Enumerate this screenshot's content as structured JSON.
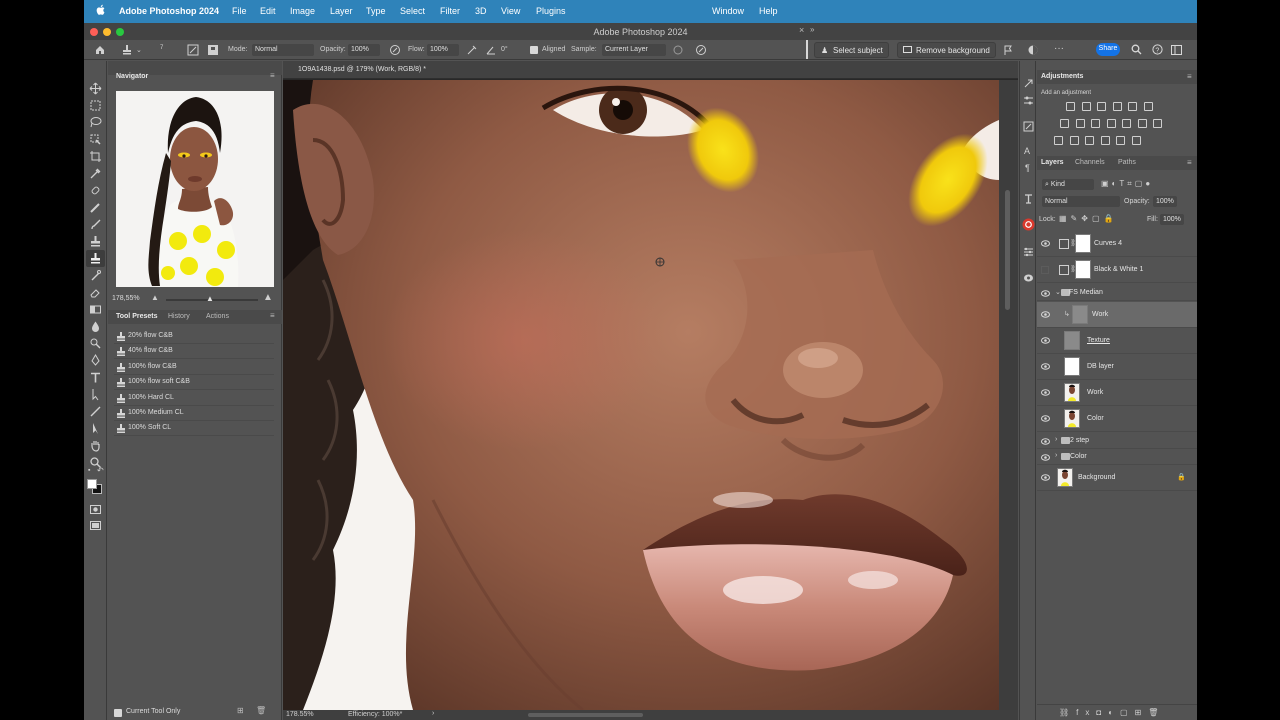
{
  "menubar": {
    "app_name": "Adobe Photoshop 2024",
    "items": [
      "File",
      "Edit",
      "Image",
      "Layer",
      "Type",
      "Select",
      "Filter",
      "3D",
      "View",
      "Plugins"
    ],
    "right_items": [
      "Window",
      "Help"
    ]
  },
  "window": {
    "title": "Adobe Photoshop 2024"
  },
  "options_bar": {
    "brush_size": "7",
    "mode_label": "Mode:",
    "mode_value": "Normal",
    "opacity_label": "Opacity:",
    "opacity_value": "100%",
    "flow_label": "Flow:",
    "flow_value": "100%",
    "angle_value": "0°",
    "aligned_label": "Aligned",
    "sample_label": "Sample:",
    "sample_value": "Current Layer",
    "select_subject": "Select subject",
    "remove_background": "Remove background",
    "share": "Share"
  },
  "navigator": {
    "tab": "Navigator",
    "zoom": "178,55%"
  },
  "tool_presets": {
    "tabs": [
      "Tool Presets",
      "History",
      "Actions"
    ],
    "items": [
      "20% flow C&B",
      "40% flow C&B",
      "100% flow C&B",
      "100% flow soft C&B",
      "100% Hard CL",
      "100% Medium CL",
      "100% Soft CL"
    ],
    "footer": "Current Tool Only"
  },
  "document": {
    "tab_title": "1O9A1438.psd @ 179% (Work, RGB/8) *",
    "status_zoom": "178.55%",
    "status_info": "Efficiency: 100%*"
  },
  "adjustments": {
    "tab": "Adjustments",
    "subtitle": "Add an adjustment"
  },
  "layers_panel": {
    "tabs": [
      "Layers",
      "Channels",
      "Paths"
    ],
    "filter_kind": "Kind",
    "blend_mode": "Normal",
    "opacity_label": "Opacity:",
    "opacity_value": "100%",
    "lock_label": "Lock:",
    "fill_label": "Fill:",
    "fill_value": "100%",
    "layers": [
      {
        "name": "Curves 4"
      },
      {
        "name": "Black & White 1"
      },
      {
        "name": "FS Median"
      },
      {
        "name": "Work"
      },
      {
        "name": "Texture"
      },
      {
        "name": "DB layer"
      },
      {
        "name": "Work"
      },
      {
        "name": "Color"
      },
      {
        "name": "2 step"
      },
      {
        "name": "Color"
      },
      {
        "name": "Background"
      }
    ]
  },
  "colors": {
    "menubar": "#2f83ba",
    "panel": "#535353",
    "selection": "#6a6a6a",
    "share": "#1473e6",
    "eyeshadow": "#f6d40a",
    "skin": "#8a5a45"
  }
}
